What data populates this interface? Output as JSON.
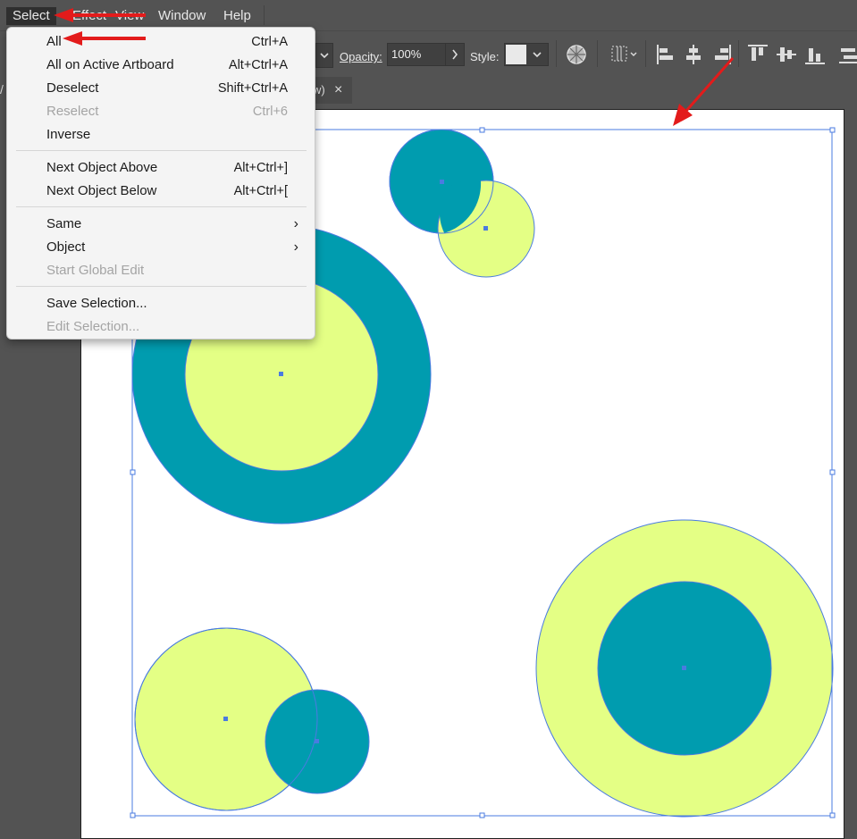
{
  "menubar": {
    "items": [
      "Select",
      "Effect",
      "View",
      "Window",
      "Help"
    ],
    "active": "Select"
  },
  "control_bar": {
    "opacity_label": "Opacity:",
    "opacity_value": "100%",
    "style_label": "Style:"
  },
  "tab": {
    "title_fragment": "w)",
    "close_glyph": "×",
    "left_fragment": "/"
  },
  "select_menu": {
    "items": [
      {
        "label": "All",
        "shortcut": "Ctrl+A",
        "disabled": false
      },
      {
        "label": "All on Active Artboard",
        "shortcut": "Alt+Ctrl+A",
        "disabled": false
      },
      {
        "label": "Deselect",
        "shortcut": "Shift+Ctrl+A",
        "disabled": false
      },
      {
        "label": "Reselect",
        "shortcut": "Ctrl+6",
        "disabled": true
      },
      {
        "label": "Inverse",
        "shortcut": "",
        "disabled": false
      },
      {
        "label": "Next Object Above",
        "shortcut": "Alt+Ctrl+]",
        "disabled": false
      },
      {
        "label": "Next Object Below",
        "shortcut": "Alt+Ctrl+[",
        "disabled": false
      },
      {
        "label": "Same",
        "submenu": true,
        "disabled": false
      },
      {
        "label": "Object",
        "submenu": true,
        "disabled": false
      },
      {
        "label": "Start Global Edit",
        "disabled": true
      },
      {
        "label": "Save Selection...",
        "disabled": false
      },
      {
        "label": "Edit Selection...",
        "disabled": true
      }
    ],
    "submenu_glyph": "›"
  },
  "colors": {
    "teal": "#009caf",
    "lime": "#e4ff85",
    "selection": "#4a7be0",
    "annotation_arrow": "#e31b1b",
    "ui_dark": "#535353"
  },
  "icons": [
    "globe-icon",
    "grid-distribute-icon",
    "align-left-icon",
    "align-hcenter-icon",
    "align-right-icon",
    "align-top-icon",
    "align-vcenter-icon",
    "align-bottom-icon"
  ]
}
